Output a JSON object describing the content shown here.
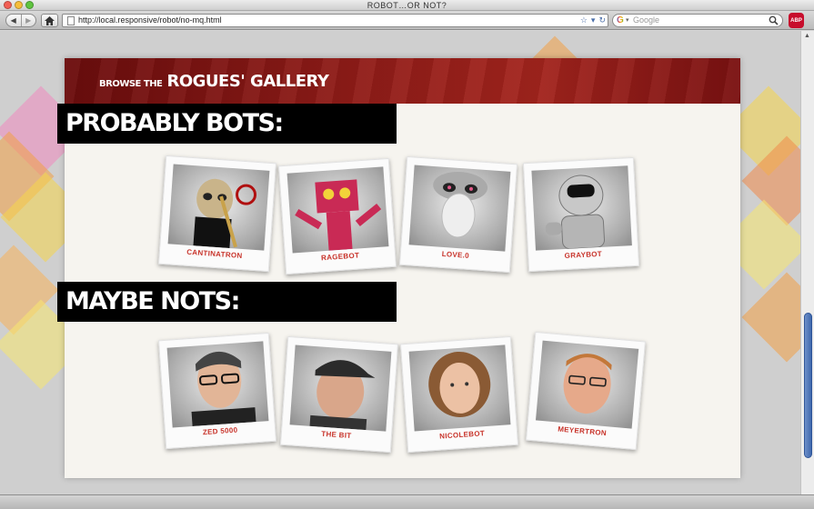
{
  "window": {
    "title": "ROBOT…OR NOT?"
  },
  "toolbar": {
    "back": "◀",
    "forward": "▶",
    "url": "http://local.responsive/robot/no-mq.html",
    "search_placeholder": "Google",
    "addon_label": "ABP"
  },
  "banner": {
    "prefix": "BROWSE THE",
    "title": "ROGUES' GALLERY"
  },
  "sections": [
    {
      "heading": "PROBABLY BOTS:",
      "items": [
        {
          "label": "CANTINATRON"
        },
        {
          "label": "RAGEBOT"
        },
        {
          "label": "LOVE.0"
        },
        {
          "label": "GRAYBOT"
        }
      ]
    },
    {
      "heading": "MAYBE NOTS:",
      "items": [
        {
          "label": "ZED 5000"
        },
        {
          "label": "THE BIT"
        },
        {
          "label": "NICOLEBOT"
        },
        {
          "label": "MEYERTRON"
        }
      ]
    }
  ],
  "colors": {
    "banner": "#8e1b17",
    "caption": "#c8332a",
    "heading_bg": "#000000"
  }
}
